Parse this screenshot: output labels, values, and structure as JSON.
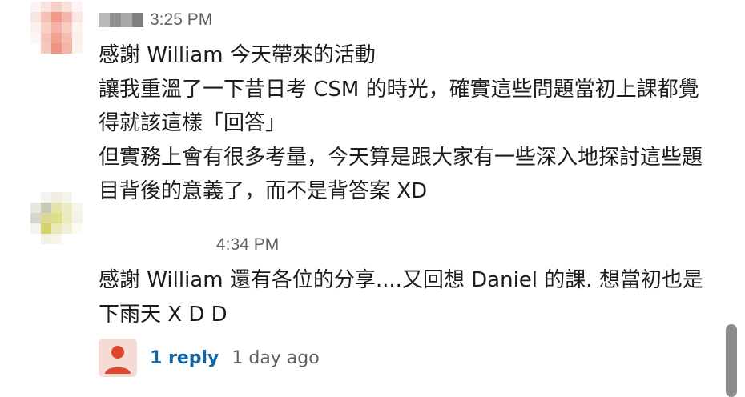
{
  "messages": [
    {
      "timestamp": "3:25 PM",
      "lines": [
        "感謝 William 今天帶來的活動",
        "讓我重溫了一下昔日考 CSM 的時光，確實這些問題當初上課都覺得就該這樣「回答」",
        "但實務上會有很多考量，今天算是跟大家有一些深入地探討這些題目背後的意義了，而不是背答案 XD"
      ]
    },
    {
      "timestamp": "4:34 PM",
      "lines": [
        "感謝 William 還有各位的分享....又回想 Daniel 的課. 想當初也是下雨天  X D D"
      ]
    }
  ],
  "thread": {
    "reply_count": "1 reply",
    "last_reply": "1 day ago"
  },
  "icons": {
    "reply_avatar": "person-icon"
  },
  "colors": {
    "link": "#1264a3",
    "muted": "#616061",
    "text": "#1d1c1d",
    "reply_avatar_bg": "#f4dbd4",
    "reply_avatar_fg": "#e0452d"
  }
}
